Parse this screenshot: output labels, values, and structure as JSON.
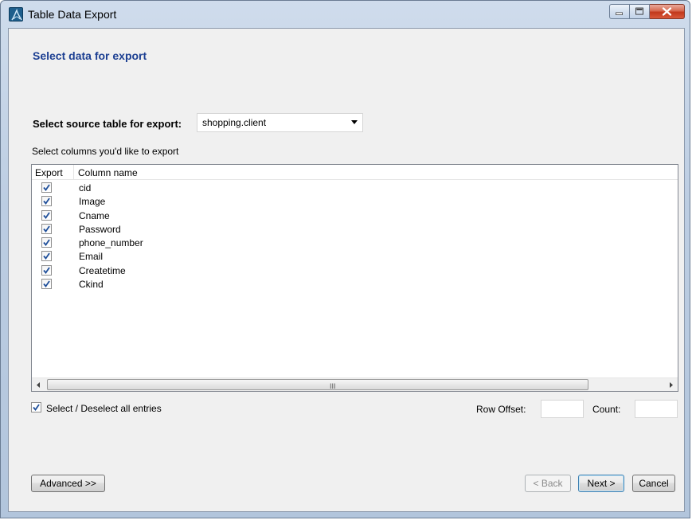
{
  "window": {
    "title": "Table Data Export",
    "icon": "mysql-workbench-icon",
    "controls": [
      "minimize-icon",
      "maximize-icon",
      "close-icon"
    ]
  },
  "page": {
    "heading": "Select data for export",
    "source_label": "Select source table for export:",
    "source_value": "shopping.client",
    "columns_label": "Select columns you'd like to export"
  },
  "grid": {
    "headers": {
      "export": "Export",
      "column_name": "Column name"
    },
    "rows": [
      {
        "checked": true,
        "name": "cid"
      },
      {
        "checked": true,
        "name": "Image"
      },
      {
        "checked": true,
        "name": "Cname"
      },
      {
        "checked": true,
        "name": "Password"
      },
      {
        "checked": true,
        "name": "phone_number"
      },
      {
        "checked": true,
        "name": "Email"
      },
      {
        "checked": true,
        "name": "Createtime"
      },
      {
        "checked": true,
        "name": "Ckind"
      }
    ],
    "scroll_grip": "III"
  },
  "options": {
    "select_all_label": "Select / Deselect all entries",
    "select_all_checked": true,
    "row_offset_label": "Row Offset:",
    "row_offset_value": "",
    "count_label": "Count:",
    "count_value": ""
  },
  "buttons": {
    "advanced": "Advanced >>",
    "back": "< Back",
    "next": "Next >",
    "cancel": "Cancel"
  },
  "colors": {
    "heading": "#1c3f92",
    "check": "#1f4f9a",
    "dialog_bg": "#f0f0f0"
  }
}
